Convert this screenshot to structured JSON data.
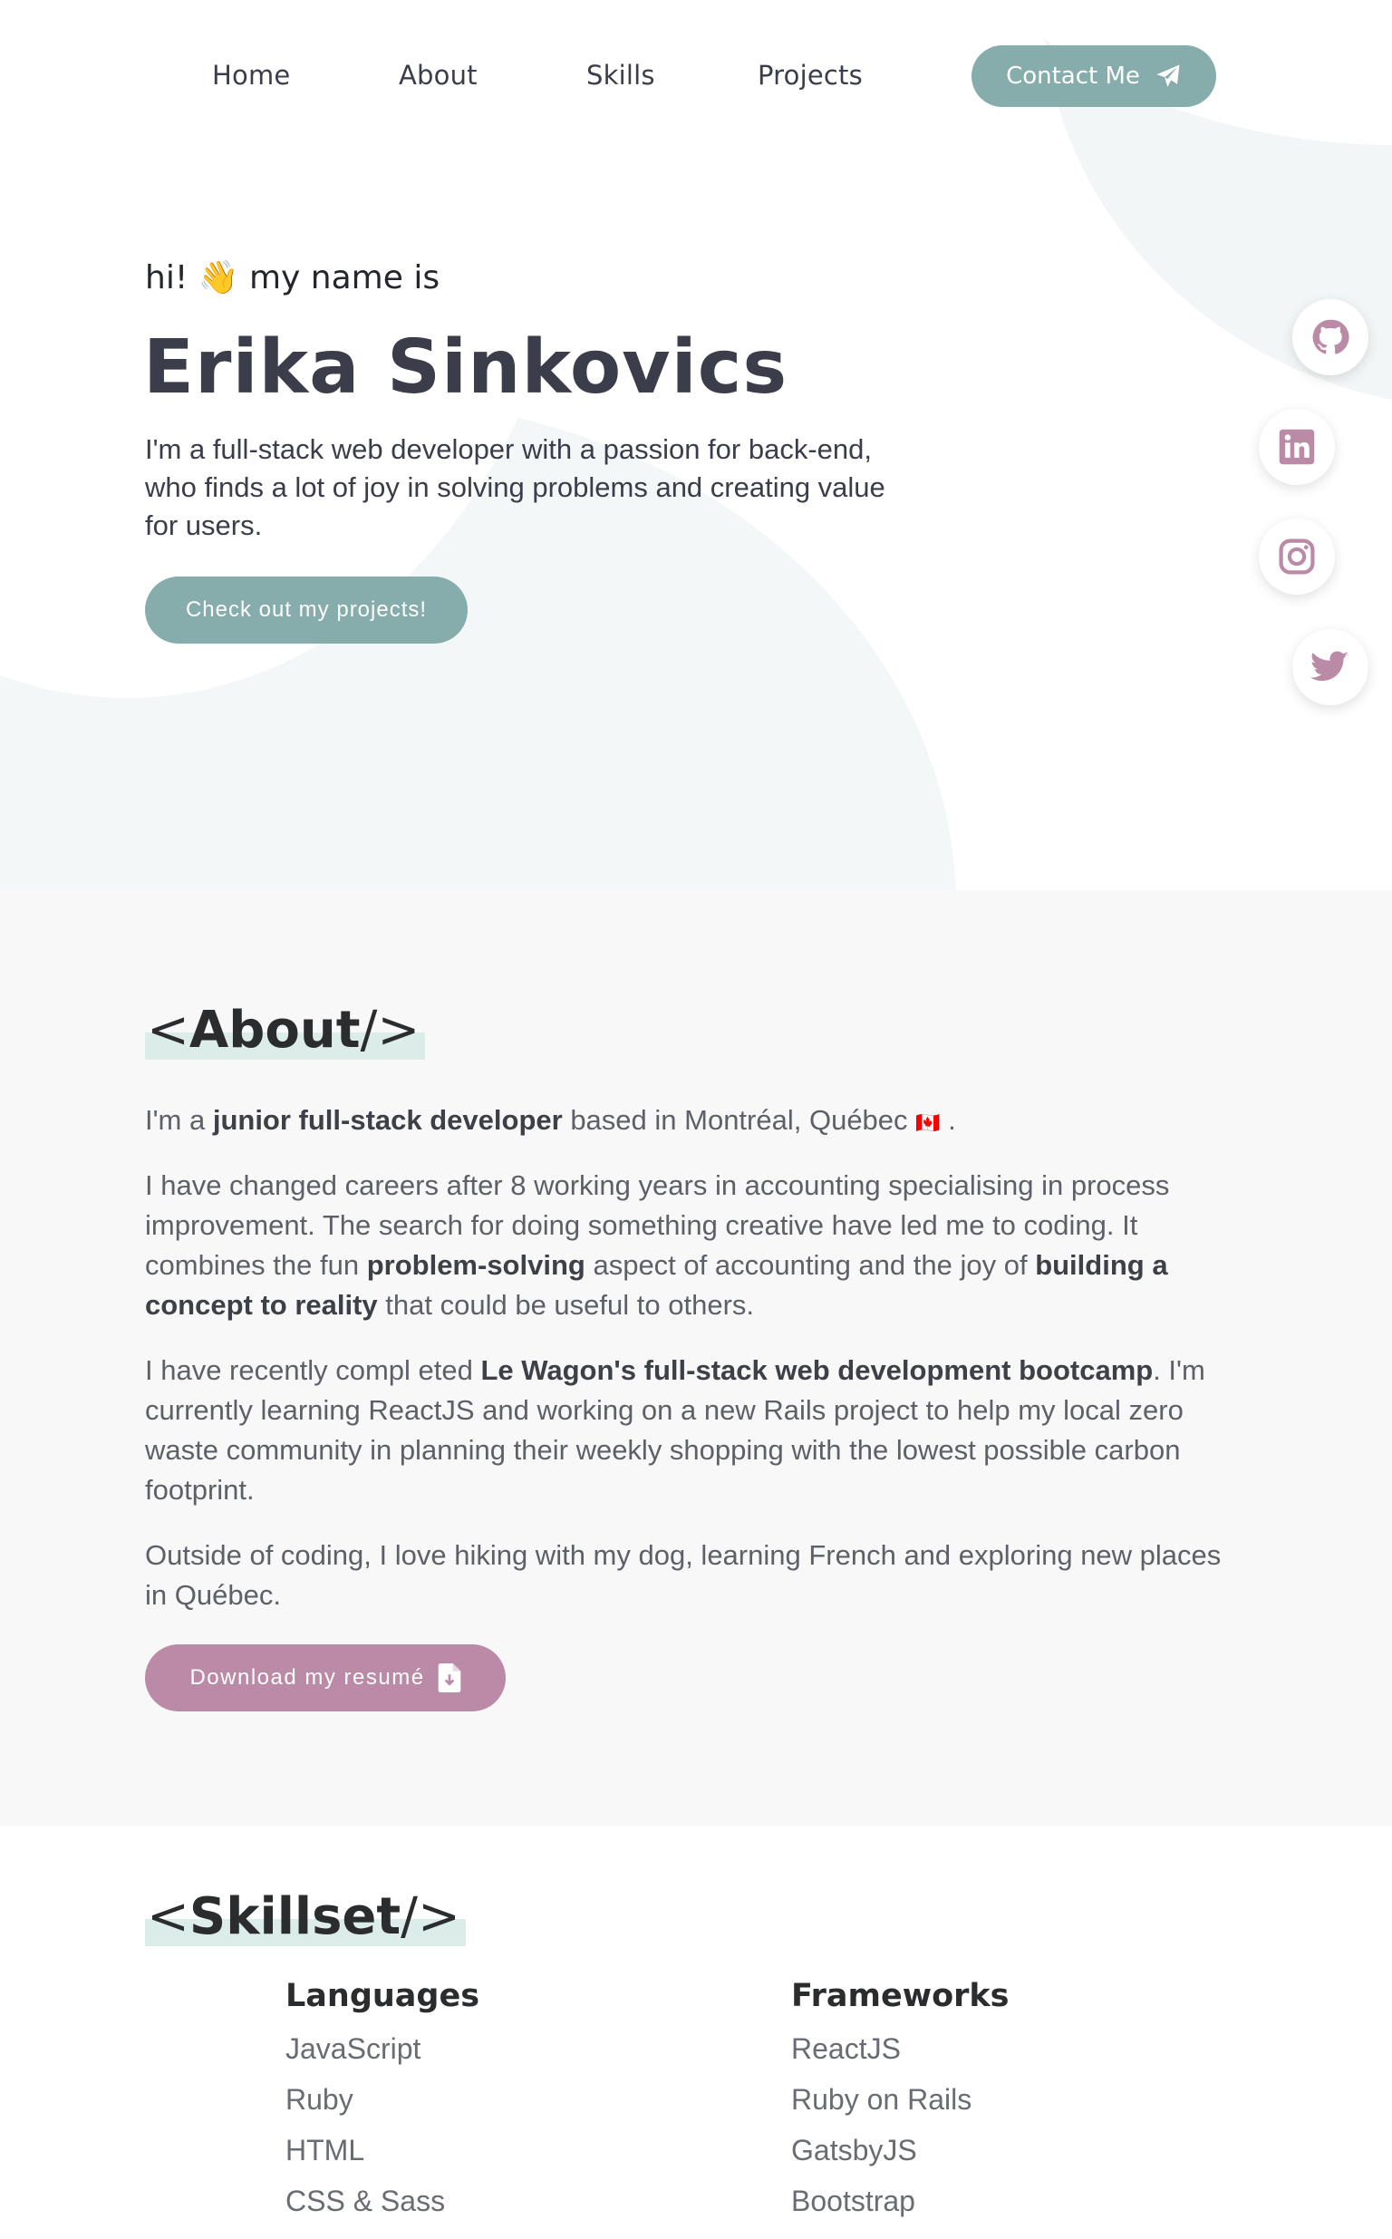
{
  "nav": {
    "links": [
      "Home",
      "About",
      "Skills",
      "Projects"
    ],
    "contact_label": "Contact Me"
  },
  "hero": {
    "greeting_pre": "hi!",
    "greeting_emoji": "👋",
    "greeting_post": "my name is",
    "name": "Erika Sinkovics",
    "intro": "I'm a full-stack web developer with a passion for back-end, who finds a lot of joy in solving problems and creating value for users.",
    "cta": "Check out my projects!"
  },
  "social": [
    "github-icon",
    "linkedin-icon",
    "instagram-icon",
    "twitter-icon"
  ],
  "about": {
    "heading_open": "<",
    "heading": "About",
    "heading_close": "/>",
    "p1_a": "I'm a ",
    "p1_b": "junior full-stack developer",
    "p1_c": " based in Montréal, Québec ",
    "p1_flag": "🇨🇦",
    "p1_d": " .",
    "p2_a": "I have changed careers after 8 working years in accounting specialising in process improvement. The search for doing something creative have led me to coding. It combines the fun ",
    "p2_b": "problem-solving",
    "p2_c": " aspect of accounting and the joy of ",
    "p2_d": "building a concept to reality",
    "p2_e": " that could be useful to others.",
    "p3_a": "I have recently compl eted ",
    "p3_b": "Le Wagon's full-stack web development bootcamp",
    "p3_c": ". I'm currently learning ReactJS and working on a new Rails project to help my local zero waste community in planning their weekly shopping with the lowest possible carbon footprint.",
    "p4": "Outside of coding, I love hiking with my dog, learning French and exploring new places in Québec.",
    "resume_label": "Download my resumé"
  },
  "skills": {
    "heading_open": "<",
    "heading": "Skillset",
    "heading_close": "/>",
    "languages_title": "Languages",
    "languages": [
      "JavaScript",
      "Ruby",
      "HTML",
      "CSS & Sass"
    ],
    "frameworks_title": "Frameworks",
    "frameworks": [
      "ReactJS",
      "Ruby on Rails",
      "GatsbyJS",
      "Bootstrap"
    ]
  },
  "colors": {
    "accent_teal": "#86adab",
    "accent_mauve": "#bb8aa6",
    "highlight": "#dcede9",
    "text_dark": "#3b3d4a"
  }
}
